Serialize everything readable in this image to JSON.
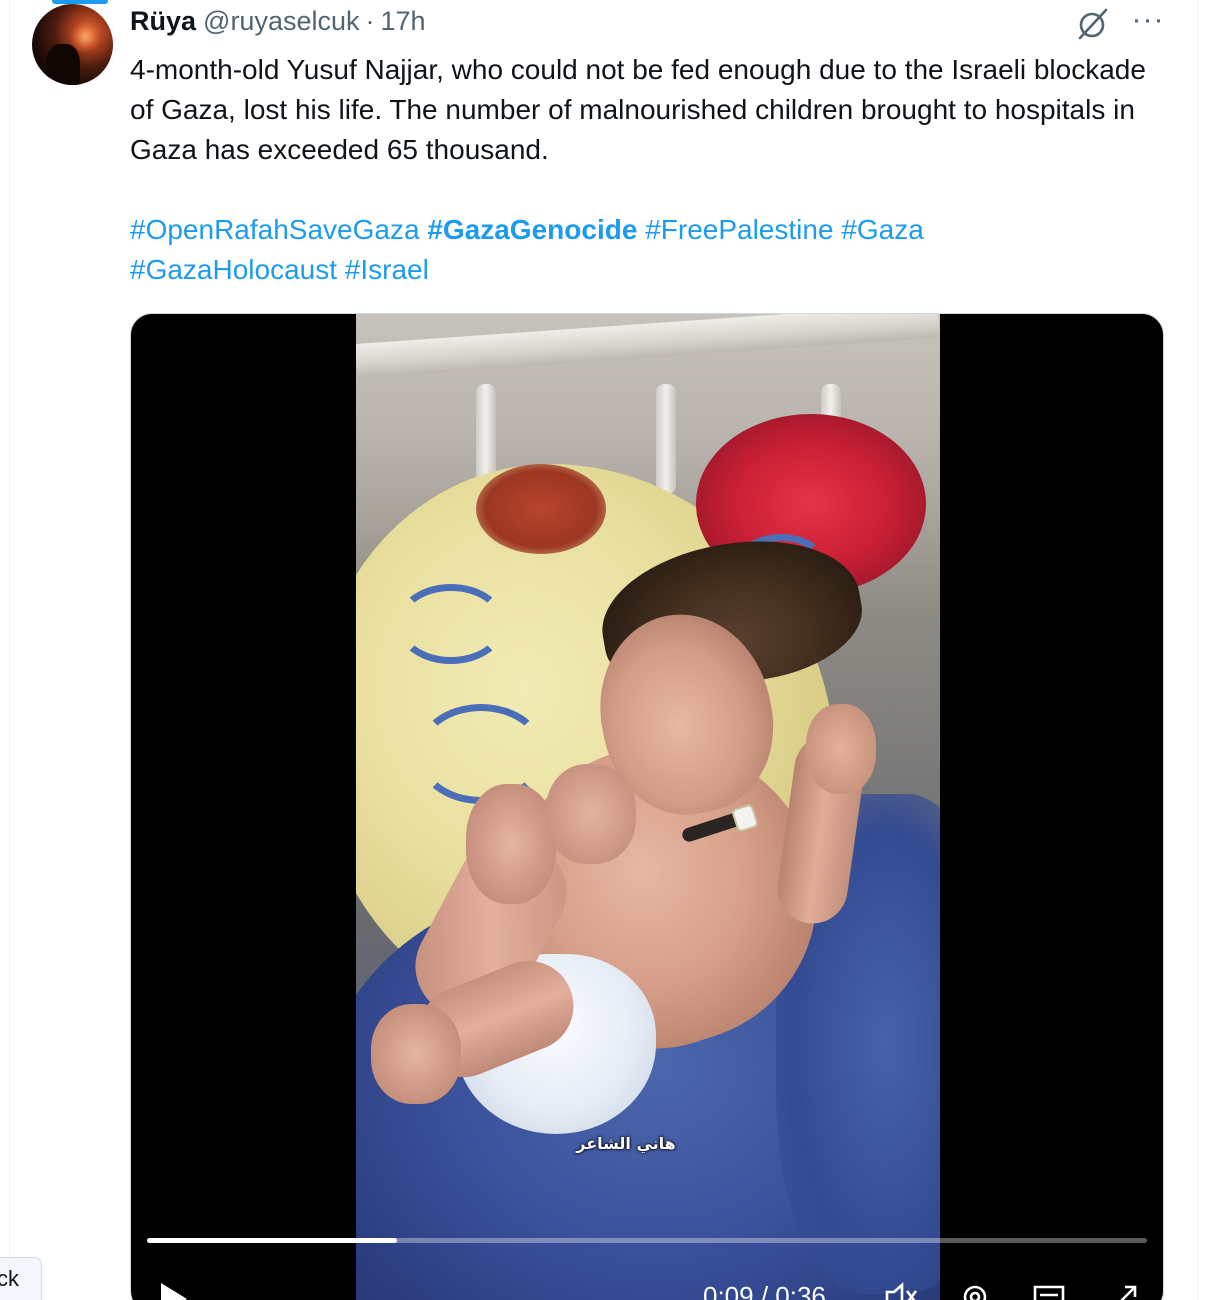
{
  "tweet": {
    "author_name": "Rüya",
    "author_handle": "@ruyaselcuk",
    "separator": "·",
    "timestamp": "17h",
    "text": "4-month-old Yusuf Najjar, who could not be fed enough due to the Israeli blockade of Gaza, lost his life. The number of malnourished children brought to hospitals in Gaza has exceeded 65 thousand.",
    "hashtags": [
      {
        "text": "#OpenRafahSaveGaza",
        "bold": false
      },
      {
        "text": "#GazaGenocide",
        "bold": true
      },
      {
        "text": "#FreePalestine",
        "bold": false
      },
      {
        "text": "#Gaza",
        "bold": false
      },
      {
        "text": "#GazaHolocaust",
        "bold": false
      },
      {
        "text": "#Israel",
        "bold": false
      }
    ]
  },
  "header_icons": {
    "grok": "grok-icon",
    "more": "more-icon",
    "more_glyph": "···"
  },
  "video": {
    "caption": "هاني الشاعر",
    "time_readout": "0:09 / 0:36",
    "progress_fraction": 0.25,
    "controls": [
      "play-icon",
      "volume-icon",
      "settings-icon",
      "subtitles-icon",
      "fullscreen-icon"
    ]
  },
  "sidebar_tab": {
    "label": "ck"
  },
  "colors": {
    "accent": "#1d9bf0",
    "text_primary": "#0f1419",
    "text_secondary": "#536471"
  }
}
